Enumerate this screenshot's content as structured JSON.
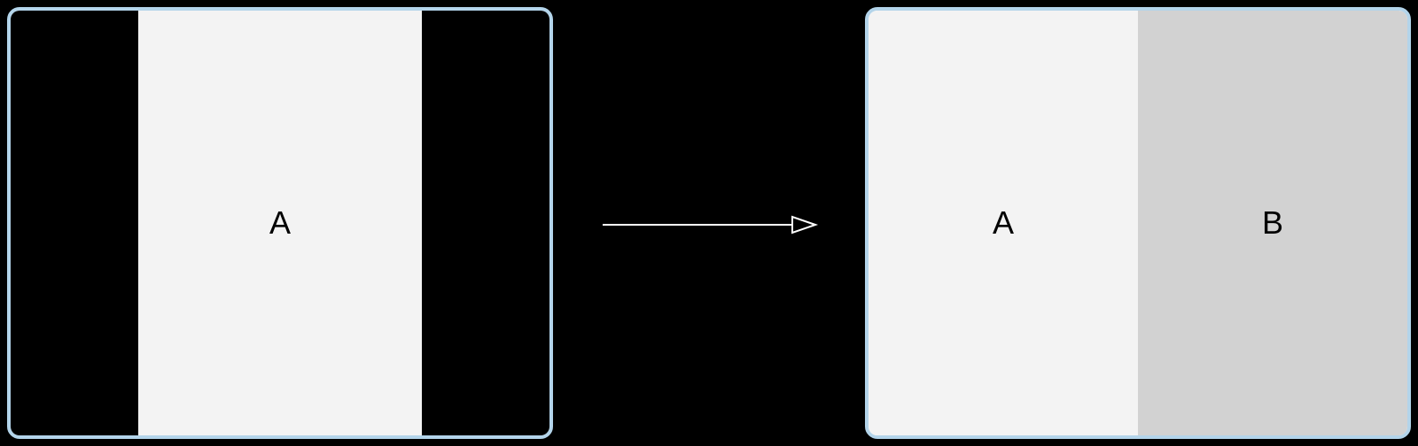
{
  "left_panel": {
    "center_label": "A"
  },
  "right_panel": {
    "left_label": "A",
    "right_label": "B"
  },
  "colors": {
    "border": "#b3d4ea",
    "light_region": "#f3f3f3",
    "dark_region": "#d2d2d2",
    "black": "#000000",
    "arrow_stroke": "#ffffff"
  }
}
